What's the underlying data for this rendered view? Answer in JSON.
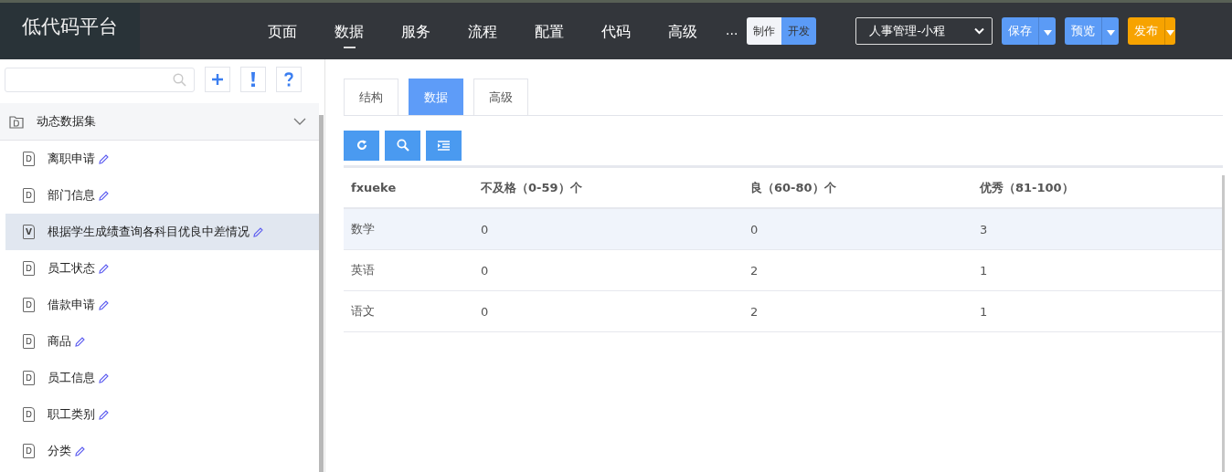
{
  "logo": "低代码平台",
  "nav": [
    {
      "label": "页面",
      "selected": false
    },
    {
      "label": "数据",
      "selected": true
    },
    {
      "label": "服务",
      "selected": false
    },
    {
      "label": "流程",
      "selected": false
    },
    {
      "label": "配置",
      "selected": false
    },
    {
      "label": "代码",
      "selected": false
    },
    {
      "label": "高级",
      "selected": false
    },
    {
      "label": "...",
      "selected": false
    }
  ],
  "mode_toggle": [
    {
      "label": "制作",
      "selected": false
    },
    {
      "label": "开发",
      "selected": true
    }
  ],
  "app_select": {
    "value": "人事管理-小程"
  },
  "actions": [
    {
      "label": "保存",
      "kind": "primary"
    },
    {
      "label": "预览",
      "kind": "primary"
    },
    {
      "label": "发布",
      "kind": "warning"
    }
  ],
  "sidebar": {
    "group": {
      "label": "动态数据集",
      "expanded": true
    },
    "items": [
      {
        "label": "离职申请",
        "type": "D",
        "selected": false
      },
      {
        "label": "部门信息",
        "type": "D",
        "selected": false
      },
      {
        "label": "根据学生成绩查询各科目优良中差情况",
        "type": "V",
        "selected": true
      },
      {
        "label": "员工状态",
        "type": "D",
        "selected": false
      },
      {
        "label": "借款申请",
        "type": "D",
        "selected": false
      },
      {
        "label": "商品",
        "type": "D",
        "selected": false
      },
      {
        "label": "员工信息",
        "type": "D",
        "selected": false
      },
      {
        "label": "职工类别",
        "type": "D",
        "selected": false
      },
      {
        "label": "分类",
        "type": "D",
        "selected": false
      }
    ]
  },
  "tabs": [
    {
      "label": "结构",
      "selected": false
    },
    {
      "label": "数据",
      "selected": true
    },
    {
      "label": "高级",
      "selected": false
    }
  ],
  "table": {
    "columns": [
      "fxueke",
      "不及格（0-59）个",
      "良（60-80）个",
      "优秀（81-100）"
    ],
    "rows": [
      {
        "cells": [
          "数学",
          "0",
          "0",
          "3"
        ],
        "selected": true
      },
      {
        "cells": [
          "英语",
          "0",
          "2",
          "1"
        ],
        "selected": false
      },
      {
        "cells": [
          "语文",
          "0",
          "2",
          "1"
        ],
        "selected": false
      }
    ]
  }
}
